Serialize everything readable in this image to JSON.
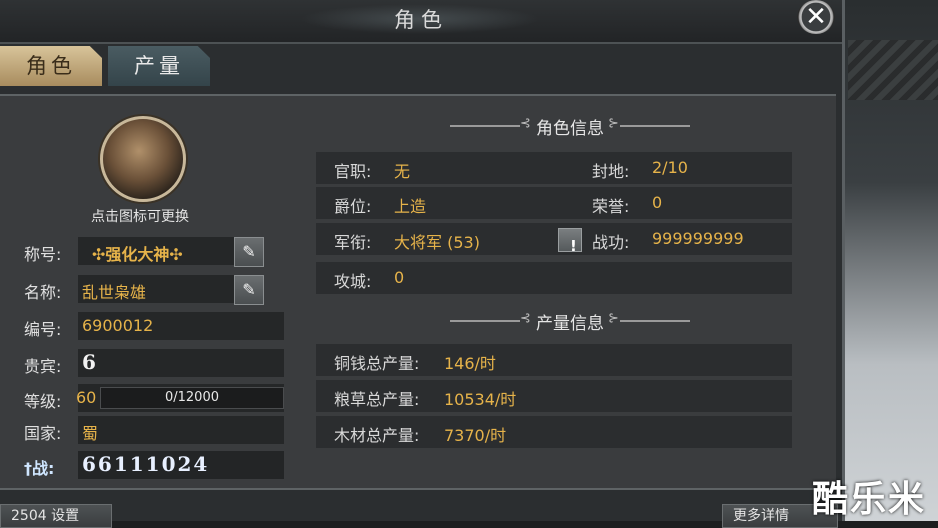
{
  "window": {
    "title": "角色",
    "close_symbol": "✕"
  },
  "tabs": [
    {
      "label": "角色"
    },
    {
      "label": "产量"
    }
  ],
  "profile": {
    "avatar_caption": "点击图标可更换",
    "title_label": "称号:",
    "title_value": "✣强化大神✣",
    "name_label": "名称:",
    "name_value": "乱世枭雄",
    "id_label": "编号:",
    "id_value": "6900012",
    "vip_label": "贵宾:",
    "vip_value": "6",
    "level_label": "等级:",
    "level_value": "60",
    "exp_text": "0/12000",
    "exp_fraction": 0,
    "nation_label": "国家:",
    "nation_value": "蜀",
    "power_label": "战:",
    "power_value": "66111024"
  },
  "role_info": {
    "heading": "角色信息",
    "rows": [
      {
        "k1": "官职:",
        "v1": "无",
        "k2": "封地:",
        "v2": "2/10"
      },
      {
        "k1": "爵位:",
        "v1": "上造",
        "k2": "荣誉:",
        "v2": "0"
      },
      {
        "k1": "军衔:",
        "v1": "大将军 (53)",
        "k2": "战功:",
        "v2": "999999999"
      },
      {
        "k1": "攻城:",
        "v1": "0"
      }
    ],
    "warn_symbol": "!"
  },
  "production_info": {
    "heading": "产量信息",
    "rows": [
      {
        "k": "铜钱总产量:",
        "v": "146/时"
      },
      {
        "k": "粮草总产量:",
        "v": "10534/时"
      },
      {
        "k": "木材总产量:",
        "v": "7370/时"
      }
    ]
  },
  "bottom": {
    "left_button": "2504 设置",
    "right_button": "更多详情"
  },
  "watermark": "酷乐米",
  "icons": [
    "close-icon",
    "edit-icon",
    "warning-icon",
    "avatar-portrait"
  ],
  "colors": {
    "gold": "#e6b34a",
    "panel": "#3a3c3e",
    "tab_active": "#c8b08a"
  }
}
